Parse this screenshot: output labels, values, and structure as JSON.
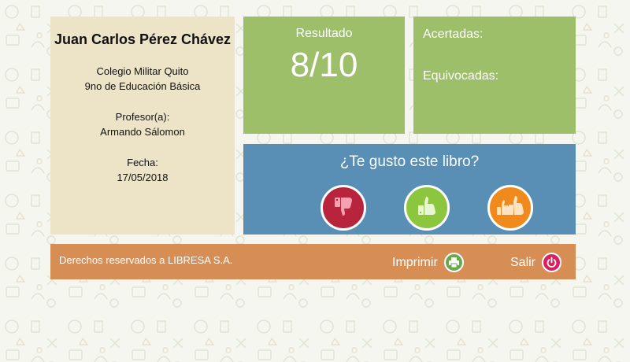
{
  "student": {
    "name": "Juan Carlos Pérez Chávez",
    "school": "Colegio Militar Quito",
    "grade": "9no de Educación Básica",
    "teacher_label": "Profesor(a):",
    "teacher": "Armando Sálomon",
    "date_label": "Fecha:",
    "date": "17/05/2018"
  },
  "result": {
    "label": "Resultado",
    "score": "8/10"
  },
  "stats": {
    "correct_label": "Acertadas:",
    "wrong_label": "Equivocadas:"
  },
  "rating": {
    "question": "¿Te gusto este libro?",
    "options": [
      {
        "icon": "thumbs-down-icon",
        "color": "#b8243c"
      },
      {
        "icon": "thumbs-up-icon",
        "color": "#8cc63f"
      },
      {
        "icon": "double-thumbs-up-icon",
        "color": "#f08a1c"
      }
    ]
  },
  "footer": {
    "copyright": "Derechos reservados a LIBRESA S.A.",
    "print_label": "Imprimir",
    "print_icon": "printer-icon",
    "exit_label": "Salir",
    "exit_icon": "power-icon"
  },
  "colors": {
    "card_green": "#9ebf69",
    "card_beige": "#ede4c8",
    "card_blue": "#5a8fb5",
    "footer_orange": "#d78e55",
    "print_green": "#6aa84f",
    "exit_pink": "#d6215e"
  }
}
